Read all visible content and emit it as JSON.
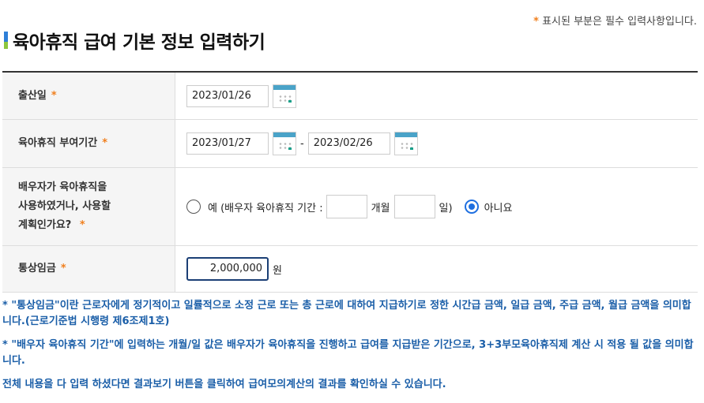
{
  "required_note": {
    "star": "*",
    "text": "표시된 부분은 필수 입력사항입니다."
  },
  "title": "육아휴직 급여 기본 정보 입력하기",
  "form": {
    "birth": {
      "label": "출산일",
      "star": "*",
      "value": "2023/01/26"
    },
    "leave_period": {
      "label": "육아휴직 부여기간",
      "star": "*",
      "start": "2023/01/27",
      "separator": "-",
      "end": "2023/02/26"
    },
    "spouse": {
      "label_line1": "배우자가 육아휴직을",
      "label_line2": "사용하였거나, 사용할",
      "label_line3": "계획인가요?",
      "star": "*",
      "yes_label": "예 (배우자 육아휴직 기간 :",
      "months_unit": "개월",
      "days_unit": "일)",
      "no_label": "아니요",
      "selected": "no"
    },
    "wage": {
      "label": "통상임금",
      "star": "*",
      "value": "2,000,000",
      "unit": "원"
    }
  },
  "notes": [
    "* \"통상임금\"이란 근로자에게 정기적이고 일률적으로 소정 근로 또는 총 근로에 대하여 지급하기로 정한 시간급 금액, 일급 금액, 주급 금액, 월급 금액을 의미합니다.(근로기준법 시행령 제6조제1호)",
    "* \"배우자 육아휴직 기간\"에 입력하는 개월/일 값은 배우자가 육아휴직을 진행하고 급여를 지급받은 기간으로, 3+3부모육아휴직제 계산 시 적용 될 값을 의미합니다.",
    "전체 내용을 다 입력 하셨다면 결과보기 버튼을 클릭하여 급여모의계산의 결과를 확인하실 수 있습니다."
  ]
}
